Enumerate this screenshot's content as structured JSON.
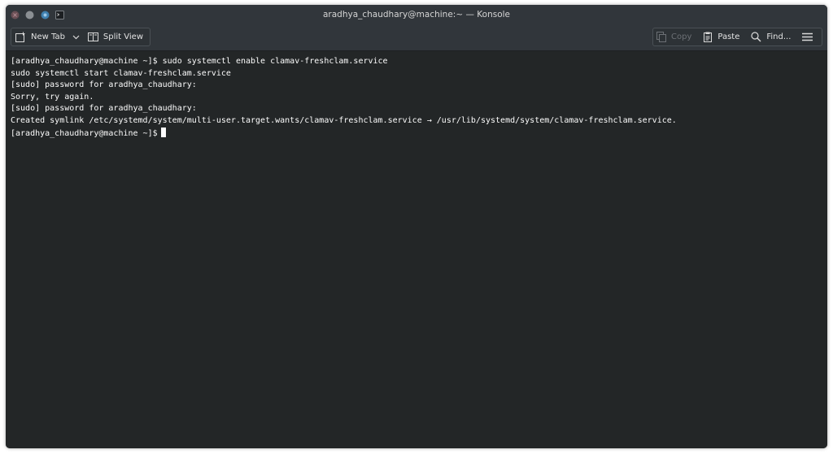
{
  "window": {
    "title": "aradhya_chaudhary@machine:~ — Konsole"
  },
  "toolbar": {
    "new_tab_label": "New Tab",
    "split_view_label": "Split View",
    "copy_label": "Copy",
    "paste_label": "Paste",
    "find_label": "Find..."
  },
  "icons": {
    "close": "close-icon",
    "minimize": "minimize-icon",
    "keep_above": "pin-icon",
    "app": "terminal-icon",
    "new_tab": "new-tab-icon",
    "split_view": "split-view-icon",
    "copy": "copy-icon",
    "paste": "paste-icon",
    "find": "search-icon",
    "menu": "hamburger-menu-icon"
  },
  "colors": {
    "terminal_bg": "#232627",
    "terminal_fg": "#fcfcfc",
    "chrome_bg": "#31363b"
  },
  "terminal": {
    "lines": [
      "[aradhya_chaudhary@machine ~]$ sudo systemctl enable clamav-freshclam.service",
      "sudo systemctl start clamav-freshclam.service",
      "[sudo] password for aradhya_chaudhary:",
      "Sorry, try again.",
      "[sudo] password for aradhya_chaudhary:",
      "Created symlink /etc/systemd/system/multi-user.target.wants/clamav-freshclam.service → /usr/lib/systemd/system/clamav-freshclam.service."
    ],
    "prompt": "[aradhya_chaudhary@machine ~]$"
  }
}
